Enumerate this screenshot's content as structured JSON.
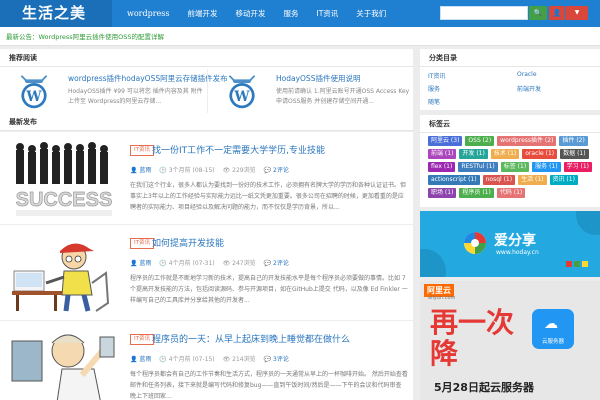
{
  "header": {
    "logo": "生活之美",
    "nav": [
      "wordpress",
      "前端开发",
      "移动开发",
      "服务",
      "IT资讯",
      "关于我们"
    ],
    "search_placeholder": "",
    "search_btn": "🔍",
    "user_btn": "👤"
  },
  "notice": "最新公告：Wordpress阿里云插件使用OSS的配置详解",
  "recommend": {
    "title": "推荐阅读",
    "items": [
      {
        "title": "wordpress插件hodayOSS阿里云存储插件发布",
        "desc": "HodayOSS插件 ¥99 可以将您 插件内容及其 附件上传至 Wordpress的阿里云存储..."
      },
      {
        "title": "HodayOSS插件使用说明",
        "desc": "使用前请确认 1.阿里云账号开通OSS Access Key 申请OSS服务 并创建存储空间开通..."
      }
    ]
  },
  "latest": {
    "title": "最新发布",
    "posts": [
      {
        "cat": "IT资讯",
        "title": "找一份IT工作不一定需要大学学历,专业技能",
        "author": "蓝雨",
        "time": "3个月前 (08-15)",
        "views": "229浏览",
        "comments": "2评论",
        "excerpt": "在我们这个行业，很多人都认为要找到一份好的技术工作，必须拥有名牌大学的学历和各种认证证书。但事实上3年以上的工作经验与实际能力远比一纸文凭更加重要。很多公司在招聘的时候，更加看重的是应聘者的实际能力、项目经验以及解决问题的能力，而不仅仅是学历背景，所以..."
      },
      {
        "cat": "IT资讯",
        "title": "如何提高开发技能",
        "author": "蓝雨",
        "time": "4个月前 (07-31)",
        "views": "247浏览",
        "comments": "2评论",
        "excerpt": "程序员的工作就是不断地学习新的技术，提高自己的开发技能水平是每个程序员必须要做的事情。比如 7个提高开发技能的方法，包括阅读源码、参与开源项目，如在GitHub上提交 代码，以及像 Ed Finkler 一样编写自己的工具库并分享给其他的开发者..."
      },
      {
        "cat": "IT资讯",
        "title": "程序员的一天：从早上起床到晚上睡觉都在做什么",
        "author": "蓝雨",
        "time": "4个月前 (07-15)",
        "views": "214浏览",
        "comments": "3评论",
        "excerpt": "每个程序员都会有自己的工作节奏和生活方式，程序员的一天通常从早上的一杯咖啡开始。 然后开始查看邮件和任务列表，接下来就是编写代码和修复bug——直到午饭时间/然后是——下午的会议和代码审查 晚上下班回家..."
      }
    ]
  },
  "categories": {
    "title": "分类目录",
    "items": [
      "IT资讯",
      "Oracle",
      "服务",
      "前端开发",
      "随笔"
    ]
  },
  "tags": {
    "title": "标签云",
    "items": [
      {
        "label": "阿里云 (3)",
        "color": "#4a6fd8"
      },
      {
        "label": "OSS (2)",
        "color": "#4cae4c"
      },
      {
        "label": "wordpress插件 (2)",
        "color": "#e57373"
      },
      {
        "label": "插件 (2)",
        "color": "#5b9bd5"
      },
      {
        "label": "前端 (1)",
        "color": "#ab47bc"
      },
      {
        "label": "开发 (1)",
        "color": "#26a69a"
      },
      {
        "label": "技术 (1)",
        "color": "#f0ad4e"
      },
      {
        "label": "oracle (1)",
        "color": "#e74c3c"
      },
      {
        "label": "数据 (1)",
        "color": "#555555"
      },
      {
        "label": "flex (1)",
        "color": "#9c27b0"
      },
      {
        "label": "RESTful (1)",
        "color": "#3f7fbf"
      },
      {
        "label": "标签 (1)",
        "color": "#5cb85c"
      },
      {
        "label": "服务 (1)",
        "color": "#2196f3"
      },
      {
        "label": "学习 (1)",
        "color": "#e91e63"
      },
      {
        "label": "actionscript (1)",
        "color": "#337ab7"
      },
      {
        "label": "nosql (1)",
        "color": "#d9534f"
      },
      {
        "label": "生活 (1)",
        "color": "#f0ad4e"
      },
      {
        "label": "资讯 (1)",
        "color": "#00acc1"
      },
      {
        "label": "职场 (1)",
        "color": "#8e44ad"
      },
      {
        "label": "程序员 (1)",
        "color": "#4cae4c"
      },
      {
        "label": "代码 (1)",
        "color": "#e57373"
      }
    ]
  },
  "ads": {
    "share_title": "爱分享",
    "share_url": "www.hoday.cn",
    "aliyun_brand": "阿里云",
    "aliyun_sub": "aliyun.com",
    "aliyun_big": "再一次降",
    "aliyun_tile": "云服务器",
    "aliyun_bottom": "5月28日起云服务器"
  }
}
